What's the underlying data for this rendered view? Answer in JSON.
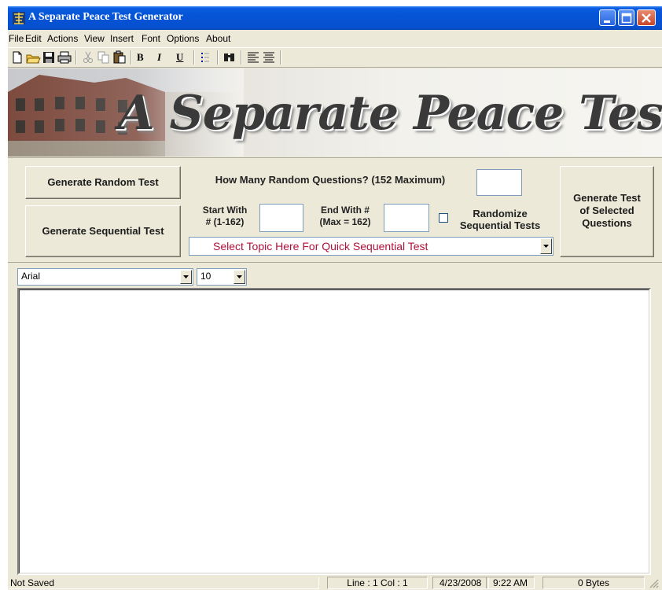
{
  "window": {
    "title": "A Separate Peace Test Generator"
  },
  "menu": [
    "File",
    "Edit",
    "Actions",
    "View",
    "Insert",
    "Font",
    "Options",
    "About"
  ],
  "toolbar": {
    "bold": "B",
    "italic": "I",
    "underline": "U"
  },
  "banner": {
    "title": "A Separate Peace Test Generator"
  },
  "controls": {
    "generate_random": "Generate Random Test",
    "generate_sequential": "Generate Sequential Test",
    "how_many_label": "How Many Random Questions? (152 Maximum)",
    "how_many_value": "",
    "start_label_1": "Start With",
    "start_label_2": "# (1-162)",
    "start_value": "",
    "end_label_1": "End With #",
    "end_label_2": "(Max = 162)",
    "end_value": "",
    "randomize_label_1": "Randomize",
    "randomize_label_2": "Sequential Tests",
    "randomize_checked": false,
    "topic_select": "Select Topic Here For Quick Sequential Test",
    "generate_selected_1": "Generate Test",
    "generate_selected_2": "of Selected",
    "generate_selected_3": "Questions"
  },
  "fontbar": {
    "font_name": "Arial",
    "font_size": "10"
  },
  "editor": {
    "content": ""
  },
  "status": {
    "saved": "Not Saved",
    "position": "Line : 1   Col : 1",
    "date": "4/23/2008",
    "time": "9:22 AM",
    "bytes": "0 Bytes"
  },
  "colors": {
    "titlebar": "#0554d6",
    "topic_text": "#b0103a",
    "window_bg": "#ece9d8"
  }
}
